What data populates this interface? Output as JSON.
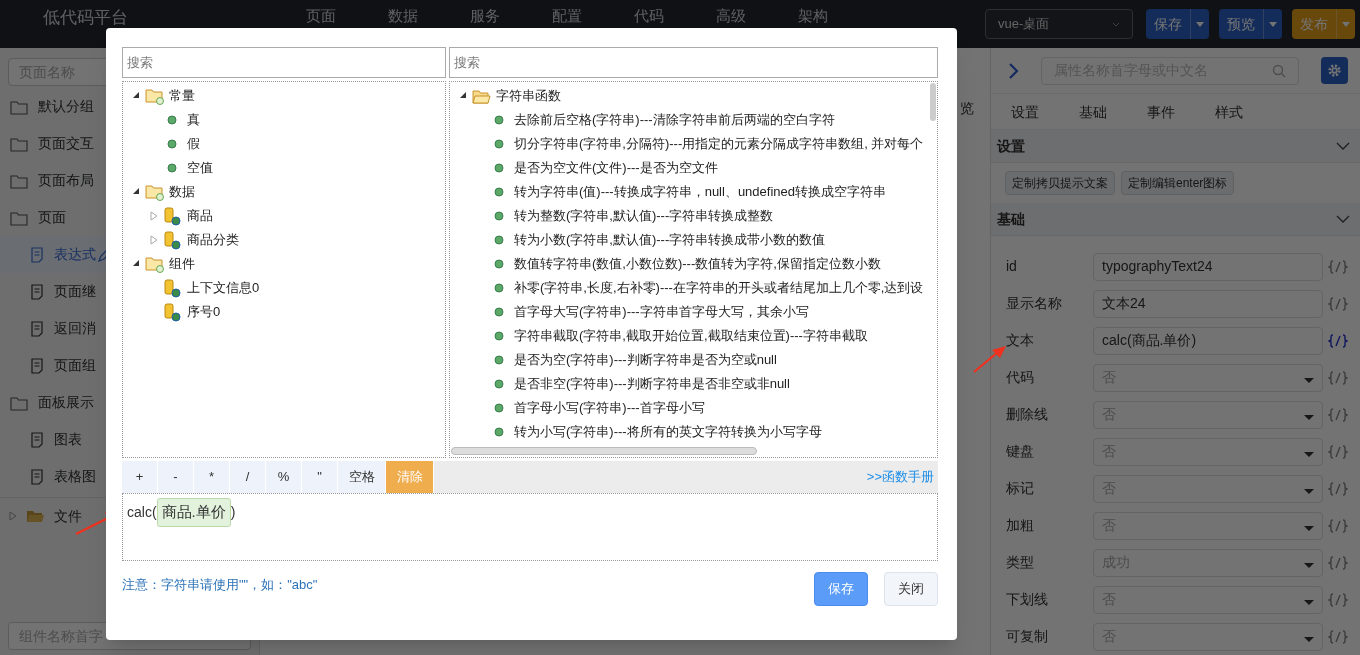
{
  "topbar": {
    "title": "低代码平台",
    "nav": [
      "页面",
      "数据",
      "服务",
      "配置",
      "代码",
      "高级",
      "架构"
    ],
    "device_select": "vue-桌面",
    "buttons": [
      {
        "label": "保存",
        "kind": "primary"
      },
      {
        "label": "预览",
        "kind": "primary"
      },
      {
        "label": "发布",
        "kind": "warning"
      }
    ]
  },
  "left_panel": {
    "search_placeholder": "页面名称",
    "items": [
      {
        "label": "默认分组",
        "kind": "folder",
        "selected": false
      },
      {
        "label": "页面交互",
        "kind": "folder",
        "selected": false
      },
      {
        "label": "页面布局",
        "kind": "folder",
        "selected": false
      },
      {
        "label": "页面",
        "kind": "folder",
        "selected": false,
        "children": [
          {
            "label": "表达式",
            "kind": "page",
            "selected": true
          },
          {
            "label": "页面继",
            "kind": "page",
            "selected": false
          },
          {
            "label": "返回消",
            "kind": "page",
            "selected": false
          },
          {
            "label": "页面组",
            "kind": "page",
            "selected": false
          }
        ]
      },
      {
        "label": "面板展示",
        "kind": "folder",
        "selected": false,
        "children": [
          {
            "label": "图表",
            "kind": "page",
            "selected": false
          },
          {
            "label": "表格图",
            "kind": "page",
            "selected": false
          }
        ]
      }
    ],
    "files": {
      "label": "文件",
      "expanded": false
    },
    "component_search_placeholder": "组件名称首字"
  },
  "canvas": {
    "fragment": "览"
  },
  "right_panel": {
    "search_placeholder": "属性名称首字母或中文名",
    "tabs": [
      {
        "label": "设置",
        "selected": false
      },
      {
        "label": "基础",
        "selected": false
      },
      {
        "label": "事件",
        "selected": false
      },
      {
        "label": "样式",
        "selected": false
      }
    ],
    "sections": [
      {
        "title": "设置",
        "expanded": true,
        "buttons": [
          "定制拷贝提示文案",
          "定制编辑enter图标"
        ]
      },
      {
        "title": "基础",
        "expanded": true,
        "fields": [
          {
            "label": "id",
            "kind": "input",
            "value": "typographyText24",
            "expression_active": false
          },
          {
            "label": "显示名称",
            "kind": "input",
            "value": "文本24",
            "expression_active": false
          },
          {
            "label": "文本",
            "kind": "input",
            "value": "calc(商品.单价)",
            "expression_active": true
          },
          {
            "label": "代码",
            "kind": "select",
            "value": "否",
            "expression_active": false
          },
          {
            "label": "删除线",
            "kind": "select",
            "value": "否",
            "expression_active": false
          },
          {
            "label": "键盘",
            "kind": "select",
            "value": "否",
            "expression_active": false
          },
          {
            "label": "标记",
            "kind": "select",
            "value": "否",
            "expression_active": false
          },
          {
            "label": "加粗",
            "kind": "select",
            "value": "否",
            "expression_active": false
          },
          {
            "label": "类型",
            "kind": "select",
            "value": "成功",
            "expression_active": false
          },
          {
            "label": "下划线",
            "kind": "select",
            "value": "否",
            "expression_active": false
          },
          {
            "label": "可复制",
            "kind": "select",
            "value": "否",
            "expression_active": false
          }
        ]
      }
    ]
  },
  "dialog": {
    "variables_search_placeholder": "搜索",
    "functions_search_placeholder": "搜索",
    "variables": [
      {
        "label": "常量",
        "kind": "folder",
        "expanded": true,
        "children": [
          {
            "label": "真",
            "kind": "constant"
          },
          {
            "label": "假",
            "kind": "constant"
          },
          {
            "label": "空值",
            "kind": "constant"
          }
        ]
      },
      {
        "label": "数据",
        "kind": "folder",
        "expanded": true,
        "children": [
          {
            "label": "商品",
            "kind": "table",
            "expanded": false
          },
          {
            "label": "商品分类",
            "kind": "table",
            "expanded": false
          }
        ]
      },
      {
        "label": "组件",
        "kind": "folder",
        "expanded": true,
        "children": [
          {
            "label": "上下文信息0",
            "kind": "table"
          },
          {
            "label": "序号0",
            "kind": "table"
          }
        ]
      }
    ],
    "functions": [
      {
        "label": "字符串函数",
        "kind": "open-folder",
        "expanded": true,
        "children": [
          {
            "label": "去除前后空格(字符串)---清除字符串前后两端的空白字符",
            "kind": "constant"
          },
          {
            "label": "切分字符串(字符串,分隔符)---用指定的元素分隔成字符串数组, 并对每个",
            "kind": "constant"
          },
          {
            "label": "是否为空文件(文件)---是否为空文件",
            "kind": "constant"
          },
          {
            "label": "转为字符串(值)---转换成字符串，null、undefined转换成空字符串",
            "kind": "constant"
          },
          {
            "label": "转为整数(字符串,默认值)---字符串转换成整数",
            "kind": "constant"
          },
          {
            "label": "转为小数(字符串,默认值)---字符串转换成带小数的数值",
            "kind": "constant"
          },
          {
            "label": "数值转字符串(数值,小数位数)---数值转为字符,保留指定位数小数",
            "kind": "constant"
          },
          {
            "label": "补零(字符串,长度,右补零)---在字符串的开头或者结尾加上几个零,达到设",
            "kind": "constant"
          },
          {
            "label": "首字母大写(字符串)---字符串首字母大写，其余小写",
            "kind": "constant"
          },
          {
            "label": "字符串截取(字符串,截取开始位置,截取结束位置)---字符串截取",
            "kind": "constant"
          },
          {
            "label": "是否为空(字符串)---判断字符串是否为空或null",
            "kind": "constant"
          },
          {
            "label": "是否非空(字符串)---判断字符串是否非空或非null",
            "kind": "constant"
          },
          {
            "label": "首字母小写(字符串)---首字母小写",
            "kind": "constant"
          },
          {
            "label": "转为小写(字符串)---将所有的英文字符转换为小写字母",
            "kind": "constant"
          }
        ]
      }
    ],
    "operators": [
      {
        "label": "+",
        "kind": "operator"
      },
      {
        "label": "-",
        "kind": "operator"
      },
      {
        "label": "*",
        "kind": "operator"
      },
      {
        "label": "/",
        "kind": "operator"
      },
      {
        "label": "%",
        "kind": "operator"
      },
      {
        "label": "\"",
        "kind": "operator"
      },
      {
        "label": "空格",
        "kind": "space"
      },
      {
        "label": "清除",
        "kind": "clear"
      }
    ],
    "manual_link": ">>函数手册",
    "expression": {
      "prefix": "calc(",
      "token": "商品.单价",
      "suffix": ")"
    },
    "note": "注意：字符串请使用\"\"，如：\"abc\"",
    "buttons": [
      {
        "label": "保存",
        "kind": "primary"
      },
      {
        "label": "关闭",
        "kind": "default"
      }
    ]
  }
}
